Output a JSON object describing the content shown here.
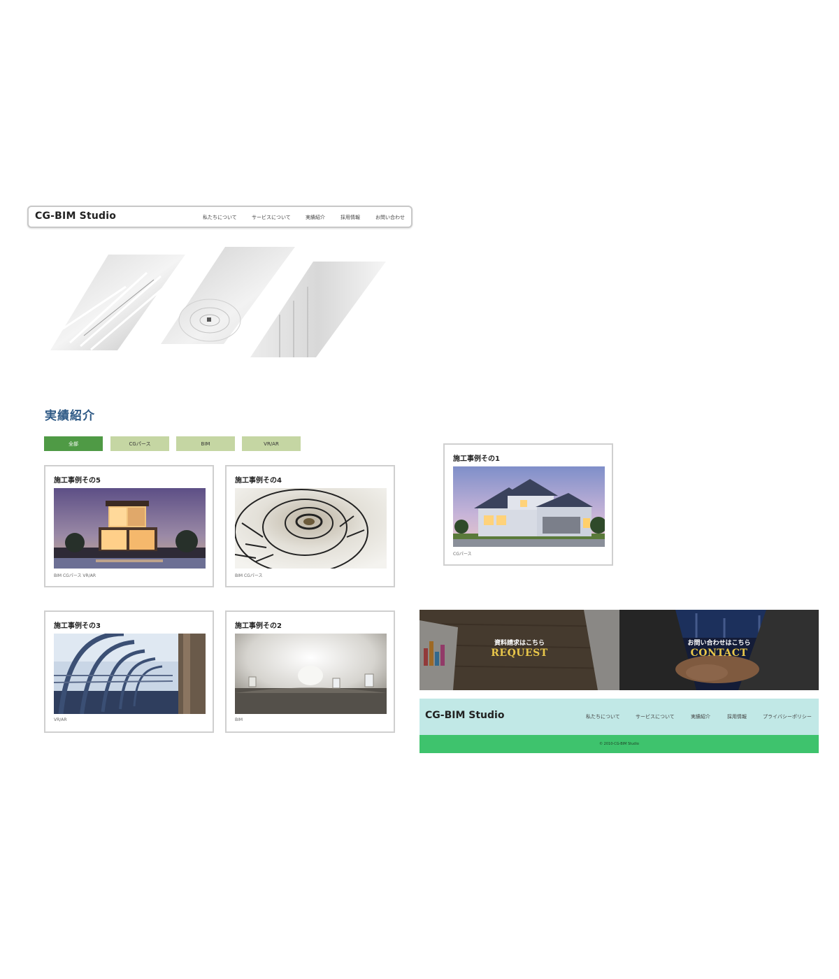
{
  "header": {
    "logo": "CG-BIM Studio",
    "nav": [
      "私たちについて",
      "サービスについて",
      "実績紹介",
      "採用情報",
      "お問い合わせ"
    ]
  },
  "section": {
    "title": "実績紹介"
  },
  "filters": [
    "全部",
    "CGパース",
    "BIM",
    "VR/AR"
  ],
  "works": [
    {
      "title": "施工事例その5",
      "tags": "BIM CGパース VR/AR"
    },
    {
      "title": "施工事例その4",
      "tags": "BIM CGパース"
    },
    {
      "title": "施工事例その3",
      "tags": "VR/AR"
    },
    {
      "title": "施工事例その2",
      "tags": "BIM"
    },
    {
      "title": "施工事例その1",
      "tags": "CGパース"
    }
  ],
  "cta": {
    "request": {
      "small": "資料請求はこちら",
      "big": "REQUEST"
    },
    "contact": {
      "small": "お問い合わせはこちら",
      "big": "CONTACT"
    }
  },
  "footer": {
    "logo": "CG-BIM Studio",
    "nav": [
      "私たちについて",
      "サービスについて",
      "実績紹介",
      "採用情報",
      "プライバシーポリシー"
    ],
    "copyright": "© 2010-CG-BIM Studio"
  },
  "colors": {
    "accent_green": "#4f9a45",
    "tab_inactive": "#c5d6a3",
    "title_blue": "#2f5a86",
    "footer_teal": "#c1e8e6",
    "copyright_green": "#3ec36d",
    "cta_gold": "#e8c64a"
  }
}
